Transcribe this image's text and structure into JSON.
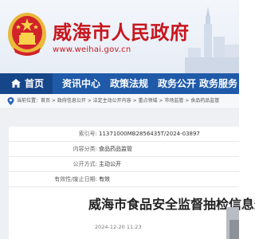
{
  "header": {
    "title": "威海市人民政府",
    "url": "www.weihai.gov.cn"
  },
  "nav": {
    "items": [
      {
        "label": "首页",
        "icon": "home-icon"
      },
      {
        "label": "资讯中心"
      },
      {
        "label": "政策法规"
      },
      {
        "label": "政务公开"
      },
      {
        "label": "政务服务"
      }
    ]
  },
  "breadcrumb": {
    "text": "当前位置：首页 > 政府信息公开 > 法定主动公开内容 > 重点领域 > 市场监管 > 食品药品监管"
  },
  "info": {
    "rows": [
      {
        "label": "索引号:",
        "value": "11371000MB2856435T/2024-03897"
      },
      {
        "label": "内容分类:",
        "value": "食品药品监管"
      },
      {
        "label": "公开方式:",
        "value": "主动公开"
      },
      {
        "label": "有效性/废止日期:",
        "value": "有效"
      }
    ]
  },
  "article": {
    "title": "威海市食品安全监督抽检信息通",
    "date": "2024-12-20 11:23"
  },
  "colors": {
    "brand_red": "#c8161d",
    "nav_blue": "#1f5aa9",
    "nav_home_blue": "#16468a"
  }
}
